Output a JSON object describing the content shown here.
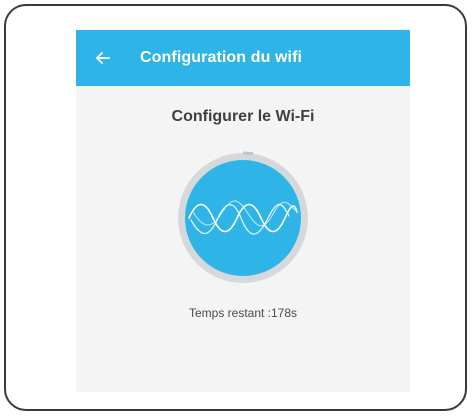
{
  "appbar": {
    "title": "Configuration du wifi",
    "back_icon": "arrow-left-icon"
  },
  "main": {
    "heading": "Configurer le Wi-Fi",
    "indicator_icon": "wifi-wave-icon",
    "timer_label": "Temps restant :178s"
  },
  "colors": {
    "accent": "#2fb4e8",
    "ring": "#d6d9dc",
    "background": "#f4f4f4"
  }
}
